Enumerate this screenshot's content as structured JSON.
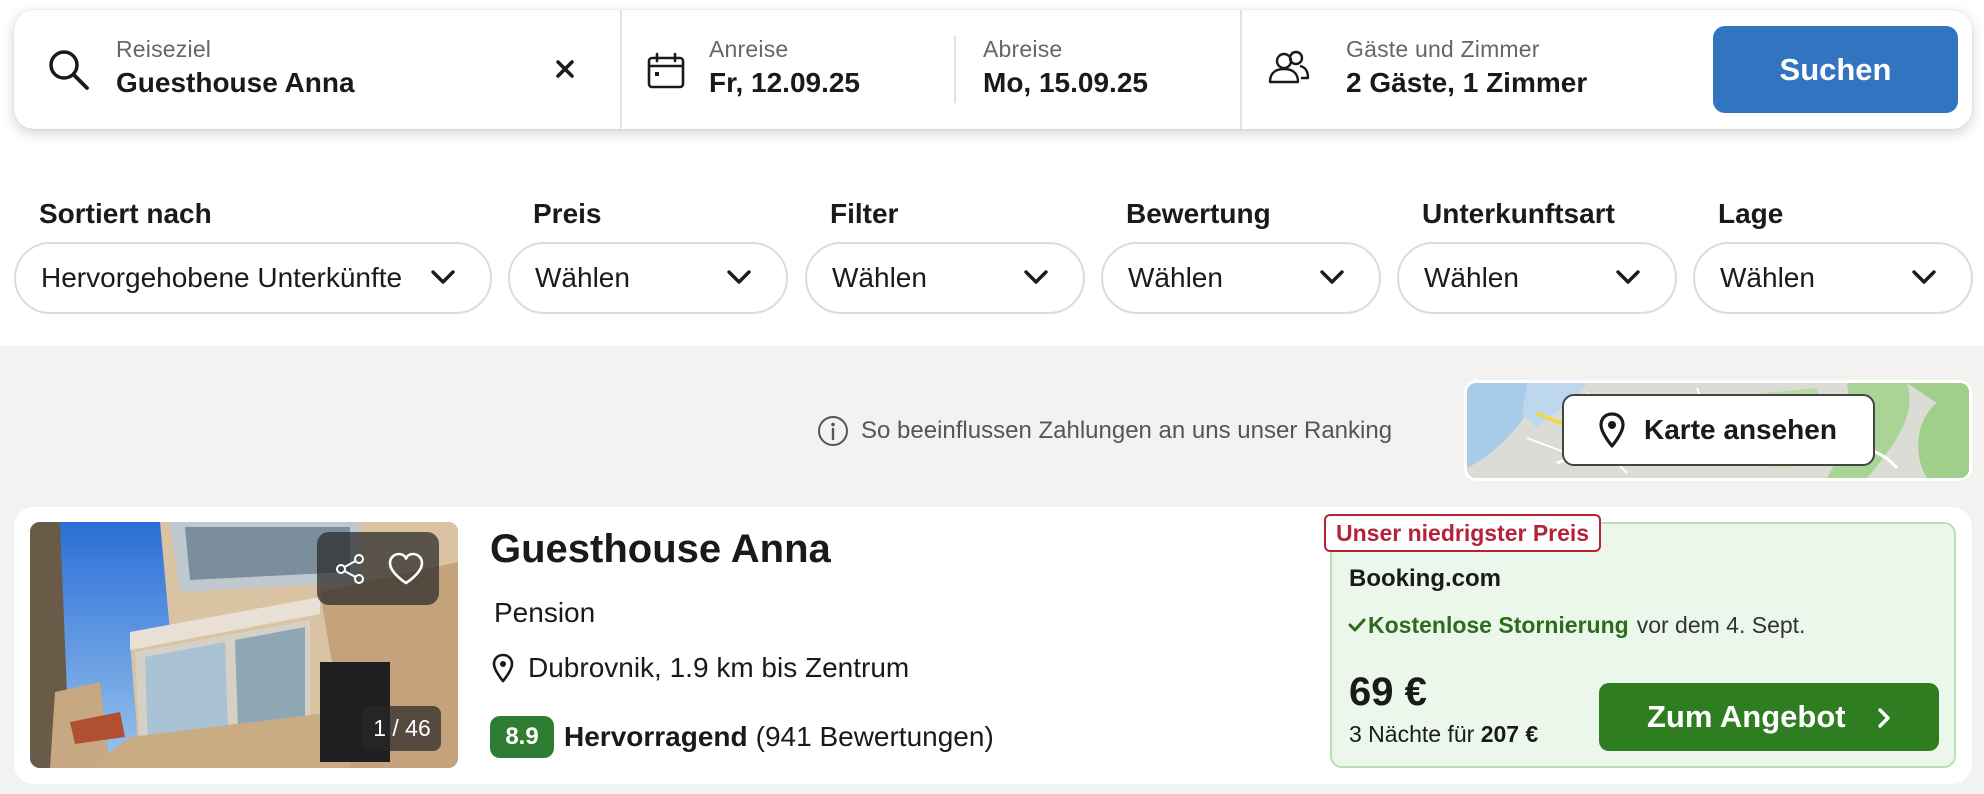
{
  "search": {
    "destination_label": "Reiseziel",
    "destination_value": "Guesthouse Anna",
    "checkin_label": "Anreise",
    "checkin_value": "Fr, 12.09.25",
    "checkout_label": "Abreise",
    "checkout_value": "Mo, 15.09.25",
    "guests_label": "Gäste und Zimmer",
    "guests_value": "2 Gäste, 1 Zimmer",
    "search_button": "Suchen",
    "accent_color": "#3274c0"
  },
  "filters": [
    {
      "title": "Sortiert nach",
      "value": "Hervorgehobene Unterkünfte"
    },
    {
      "title": "Preis",
      "value": "Wählen"
    },
    {
      "title": "Filter",
      "value": "Wählen"
    },
    {
      "title": "Bewertung",
      "value": "Wählen"
    },
    {
      "title": "Unterkunftsart",
      "value": "Wählen"
    },
    {
      "title": "Lage",
      "value": "Wählen"
    }
  ],
  "ranking_note": "So beeinflussen Zahlungen an uns unser Ranking",
  "map_button": "Karte ansehen",
  "hotel": {
    "name": "Guesthouse Anna",
    "type": "Pension",
    "location": "Dubrovnik, 1.9 km bis Zentrum",
    "score": "8.9",
    "rating_word": "Hervorragend",
    "reviews": "(941 Bewertungen)",
    "photo_counter": "1 / 46",
    "score_color": "#2e7d32"
  },
  "offer": {
    "badge": "Unser niedrigster Preis",
    "provider": "Booking.com",
    "free_cancel": "Kostenlose Stornierung",
    "cancel_until": "vor dem 4. Sept.",
    "price": "69 €",
    "total_prefix": "3 Nächte für",
    "total_value": "207 €",
    "button": "Zum Angebot",
    "button_color": "#2f7d21",
    "badge_color": "#b3233a"
  }
}
